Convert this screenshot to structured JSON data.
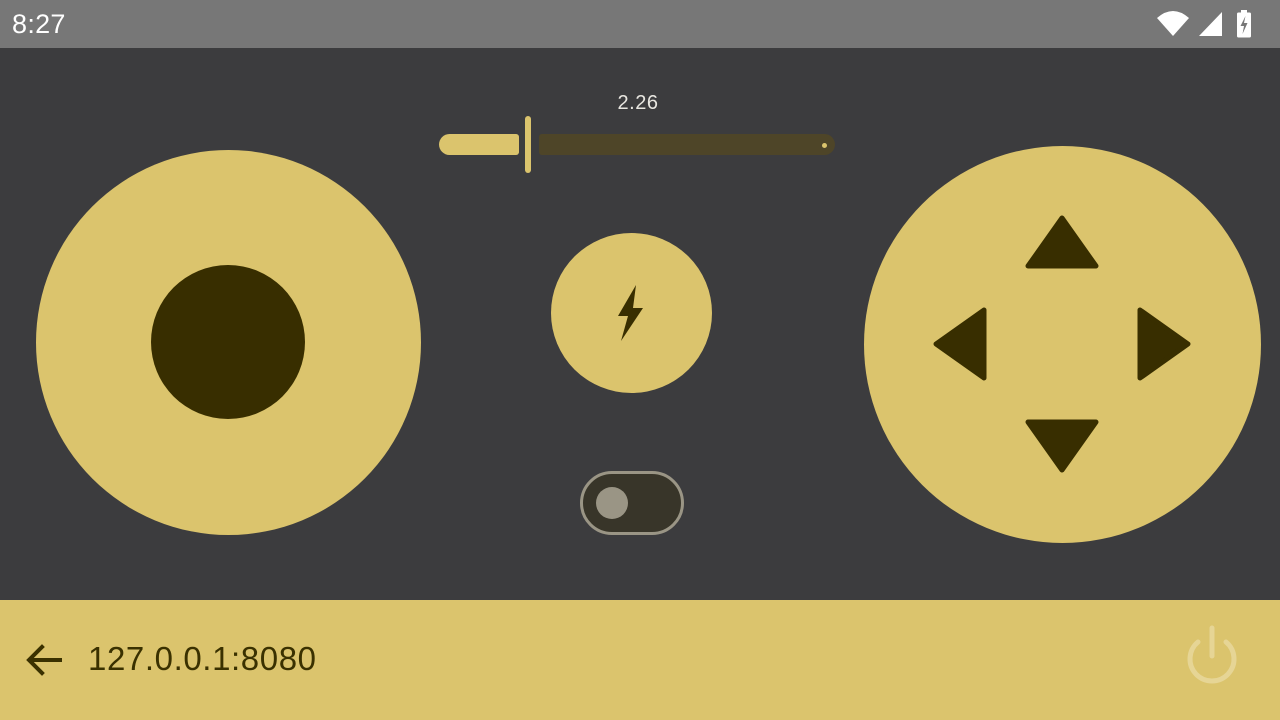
{
  "status_bar": {
    "time": "8:27",
    "icons": [
      "wifi-icon",
      "cellular-signal-icon",
      "battery-charging-icon"
    ]
  },
  "controls": {
    "slider": {
      "value_label": "2.26",
      "fill_fraction": 0.24
    },
    "turbo_icon": "lightning-bolt-icon",
    "toggle": {
      "on": false
    },
    "dpad": [
      "up-arrow-icon",
      "left-arrow-icon",
      "right-arrow-icon",
      "down-arrow-icon"
    ]
  },
  "bottom_bar": {
    "address": "127.0.0.1:8080",
    "back_icon": "arrow-back-icon",
    "power_icon": "power-icon"
  },
  "colors": {
    "accent": "#dbc46d",
    "dark_accent": "#382e00",
    "background": "#3c3c3e",
    "status_bar": "#777777"
  }
}
